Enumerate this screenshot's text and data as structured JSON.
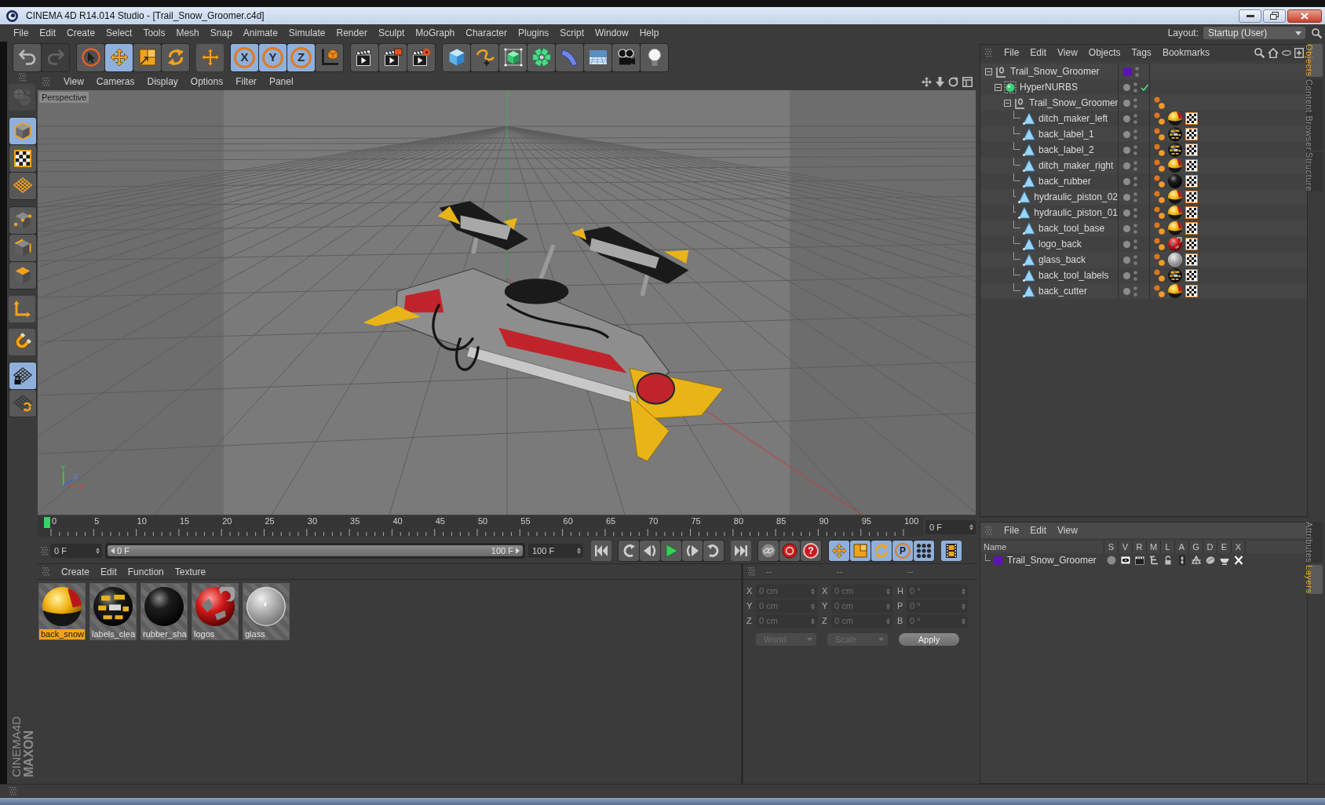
{
  "window": {
    "title": "CINEMA 4D R14.014 Studio - [Trail_Snow_Groomer.c4d]"
  },
  "menu_bar": [
    "File",
    "Edit",
    "Create",
    "Select",
    "Tools",
    "Mesh",
    "Snap",
    "Animate",
    "Simulate",
    "Render",
    "Sculpt",
    "MoGraph",
    "Character",
    "Plugins",
    "Script",
    "Window",
    "Help"
  ],
  "layout": {
    "label": "Layout:",
    "value": "Startup (User)"
  },
  "toolbar": [
    [
      {
        "kind": "undo",
        "active": false,
        "disabled": false
      },
      {
        "kind": "redo",
        "active": false,
        "disabled": true
      }
    ],
    [
      {
        "kind": "live_selection",
        "active": false,
        "disabled": false
      },
      {
        "kind": "move",
        "active": true,
        "disabled": false
      },
      {
        "kind": "scale",
        "active": false,
        "disabled": false
      },
      {
        "kind": "rotate",
        "active": false,
        "disabled": false
      }
    ],
    [
      {
        "kind": "recent_tool",
        "active": false,
        "disabled": false
      }
    ],
    [
      {
        "kind": "axis_lock",
        "label": "X",
        "active": true,
        "disabled": false
      },
      {
        "kind": "axis_lock",
        "label": "Y",
        "active": true,
        "disabled": false
      },
      {
        "kind": "axis_lock",
        "label": "Z",
        "active": true,
        "disabled": false
      },
      {
        "kind": "coordinate_system",
        "active": false,
        "disabled": false
      }
    ],
    [
      {
        "kind": "render_view",
        "active": false,
        "disabled": false
      },
      {
        "kind": "render_picture_viewer",
        "active": false,
        "disabled": false
      },
      {
        "kind": "render_settings",
        "active": false,
        "disabled": false
      }
    ],
    [
      {
        "kind": "cube",
        "active": false,
        "disabled": false
      },
      {
        "kind": "spline",
        "active": false,
        "disabled": false
      },
      {
        "kind": "subdivision",
        "active": false,
        "disabled": false
      },
      {
        "kind": "array",
        "active": false,
        "disabled": false
      },
      {
        "kind": "deformer",
        "active": false,
        "disabled": false
      },
      {
        "kind": "floor",
        "active": false,
        "disabled": false
      },
      {
        "kind": "camera",
        "active": false,
        "disabled": false
      },
      {
        "kind": "light",
        "active": false,
        "disabled": false
      }
    ]
  ],
  "left_toolbar": [
    [
      {
        "kind": "make_editable",
        "active": false,
        "disabled": true
      }
    ],
    [
      {
        "kind": "model",
        "active": true,
        "disabled": false
      },
      {
        "kind": "texture",
        "active": false,
        "disabled": false
      },
      {
        "kind": "workplane",
        "active": false,
        "disabled": false
      }
    ],
    [
      {
        "kind": "points",
        "active": false,
        "disabled": false
      },
      {
        "kind": "edges",
        "active": false,
        "disabled": false
      },
      {
        "kind": "polygons",
        "active": false,
        "disabled": false
      }
    ],
    [
      {
        "kind": "axis",
        "active": false,
        "disabled": false
      }
    ],
    [
      {
        "kind": "snap",
        "active": false,
        "disabled": false
      }
    ],
    [
      {
        "kind": "locked_workplane",
        "active": true,
        "disabled": false
      },
      {
        "kind": "align_workplane",
        "active": false,
        "disabled": false
      }
    ]
  ],
  "viewport": {
    "menu": [
      "View",
      "Cameras",
      "Display",
      "Options",
      "Filter",
      "Panel"
    ],
    "camera": "Perspective",
    "axis_labels": [
      "Y",
      "Z",
      "X"
    ]
  },
  "timeline": {
    "ticks": [
      "0",
      "5",
      "10",
      "15",
      "20",
      "25",
      "30",
      "35",
      "40",
      "45",
      "50",
      "55",
      "60",
      "65",
      "70",
      "75",
      "80",
      "85",
      "90",
      "95",
      "100"
    ],
    "playhead": {
      "level": 0
    },
    "current_frame": "0 F"
  },
  "transport": {
    "start_frame": "0 F",
    "range": {
      "start": "0 F",
      "end": "100 F",
      "level": 1
    },
    "end_frame": "100 F",
    "groups": [
      [
        {
          "kind": "goto_start",
          "active": false
        }
      ],
      [
        {
          "kind": "previous_key",
          "active": false
        },
        {
          "kind": "step_back",
          "active": false
        },
        {
          "kind": "play",
          "active": false
        },
        {
          "kind": "step_forward",
          "active": false
        },
        {
          "kind": "next_key",
          "active": false
        }
      ],
      [
        {
          "kind": "goto_end",
          "active": false
        }
      ],
      [
        {
          "kind": "record_keys",
          "active": false
        },
        {
          "kind": "autokey",
          "active": false
        },
        {
          "kind": "keyframe_selection",
          "label": "?",
          "active": false
        }
      ],
      [
        {
          "kind": "key_position",
          "active": true
        },
        {
          "kind": "key_scale",
          "active": true
        },
        {
          "kind": "key_rotation",
          "active": true
        },
        {
          "kind": "key_parameter",
          "label": "P",
          "active": true
        },
        {
          "kind": "key_points",
          "active": true
        }
      ],
      [
        {
          "kind": "timeline_window",
          "active": true
        }
      ]
    ]
  },
  "materials": {
    "menu": [
      "Create",
      "Edit",
      "Function",
      "Texture"
    ],
    "items": [
      {
        "name": "back_snow",
        "kind": "paint",
        "selected": true
      },
      {
        "name": "labels_clea",
        "kind": "labels",
        "selected": false
      },
      {
        "name": "rubber_sha",
        "kind": "rubber",
        "selected": false
      },
      {
        "name": "logos",
        "kind": "logos",
        "selected": false
      },
      {
        "name": "glass",
        "kind": "glass",
        "selected": false
      }
    ]
  },
  "coordinates": {
    "disabled": true,
    "headers": [
      "--",
      "--",
      "--"
    ],
    "rows": [
      {
        "labels": [
          "X",
          "X",
          "H"
        ],
        "values": [
          "0 cm",
          "0 cm",
          "0 °"
        ]
      },
      {
        "labels": [
          "Y",
          "Y",
          "P"
        ],
        "values": [
          "0 cm",
          "0 cm",
          "0 °"
        ]
      },
      {
        "labels": [
          "Z",
          "Z",
          "B"
        ],
        "values": [
          "0 cm",
          "0 cm",
          "0 °"
        ]
      }
    ],
    "dropdowns": [
      "World",
      "Scale"
    ],
    "button": "Apply"
  },
  "object_manager": {
    "menu": [
      "File",
      "Edit",
      "View",
      "Objects",
      "Tags",
      "Bookmarks"
    ],
    "tree": [
      {
        "name": "Trail_Snow_Groomer",
        "kind": "null",
        "color": "#5a14b4",
        "expanded": true,
        "children": [
          {
            "name": "HyperNURBS",
            "kind": "subdivision",
            "enabled": true,
            "expanded": true,
            "children": [
              {
                "name": "Trail_Snow_Groomer",
                "kind": "null",
                "expanded": true,
                "tags": [
                  {
                    "kind": "phong"
                  }
                ],
                "children": [
                  {
                    "name": "ditch_maker_left",
                    "kind": "polygon",
                    "tags": [
                      {
                        "kind": "phong"
                      },
                      {
                        "kind": "paint"
                      },
                      {
                        "kind": "uvw"
                      }
                    ]
                  },
                  {
                    "name": "back_label_1",
                    "kind": "polygon",
                    "tags": [
                      {
                        "kind": "phong"
                      },
                      {
                        "kind": "labels"
                      },
                      {
                        "kind": "uvw"
                      }
                    ]
                  },
                  {
                    "name": "back_label_2",
                    "kind": "polygon",
                    "tags": [
                      {
                        "kind": "phong"
                      },
                      {
                        "kind": "labels"
                      },
                      {
                        "kind": "uvw"
                      }
                    ]
                  },
                  {
                    "name": "ditch_maker_right",
                    "kind": "polygon",
                    "tags": [
                      {
                        "kind": "phong"
                      },
                      {
                        "kind": "paint"
                      },
                      {
                        "kind": "uvw"
                      }
                    ]
                  },
                  {
                    "name": "back_rubber",
                    "kind": "polygon",
                    "tags": [
                      {
                        "kind": "phong"
                      },
                      {
                        "kind": "rubber"
                      },
                      {
                        "kind": "uvw"
                      }
                    ]
                  },
                  {
                    "name": "hydraulic_piston_02",
                    "kind": "polygon",
                    "tags": [
                      {
                        "kind": "phong"
                      },
                      {
                        "kind": "paint"
                      },
                      {
                        "kind": "uvw"
                      }
                    ]
                  },
                  {
                    "name": "hydraulic_piston_01",
                    "kind": "polygon",
                    "tags": [
                      {
                        "kind": "phong"
                      },
                      {
                        "kind": "paint"
                      },
                      {
                        "kind": "uvw"
                      }
                    ]
                  },
                  {
                    "name": "back_tool_base",
                    "kind": "polygon",
                    "tags": [
                      {
                        "kind": "phong"
                      },
                      {
                        "kind": "paint"
                      },
                      {
                        "kind": "uvw"
                      }
                    ]
                  },
                  {
                    "name": "logo_back",
                    "kind": "polygon",
                    "tags": [
                      {
                        "kind": "phong"
                      },
                      {
                        "kind": "logos"
                      },
                      {
                        "kind": "uvw"
                      }
                    ]
                  },
                  {
                    "name": "glass_back",
                    "kind": "polygon",
                    "tags": [
                      {
                        "kind": "phong"
                      },
                      {
                        "kind": "glass"
                      },
                      {
                        "kind": "uvw"
                      }
                    ]
                  },
                  {
                    "name": "back_tool_labels",
                    "kind": "polygon",
                    "tags": [
                      {
                        "kind": "phong"
                      },
                      {
                        "kind": "labels"
                      },
                      {
                        "kind": "uvw"
                      }
                    ]
                  },
                  {
                    "name": "back_cutter",
                    "kind": "polygon",
                    "tags": [
                      {
                        "kind": "phong"
                      },
                      {
                        "kind": "paint"
                      },
                      {
                        "kind": "uvw"
                      }
                    ]
                  }
                ]
              }
            ]
          }
        ]
      }
    ]
  },
  "layer_manager": {
    "menu": [
      "File",
      "Edit",
      "View"
    ],
    "columns": [
      "Name",
      "S",
      "V",
      "R",
      "M",
      "L",
      "A",
      "G",
      "D",
      "E",
      "X"
    ],
    "rows": [
      {
        "name": "Trail_Snow_Groomer",
        "color": "#5a14b4"
      }
    ]
  },
  "side_tabs": {
    "top": [
      {
        "label": "Objects",
        "selected": true
      },
      {
        "label": "Content Browser",
        "selected": false
      },
      {
        "label": "Structure",
        "selected": false
      }
    ],
    "bottom": [
      {
        "label": "Attributes",
        "selected": false
      },
      {
        "label": "Layers",
        "selected": true
      }
    ]
  },
  "logo": {
    "brand": "MAXON",
    "product": "CINEMA4D"
  }
}
